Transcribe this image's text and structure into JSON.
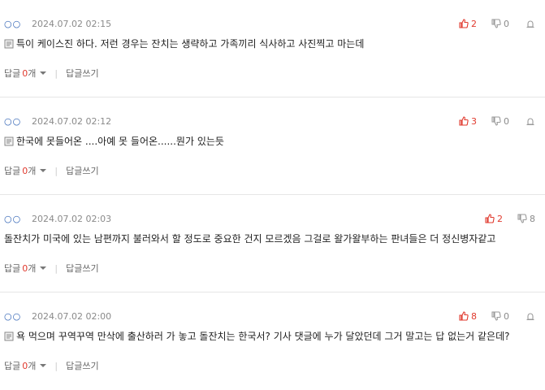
{
  "comments": [
    {
      "nick": "○○",
      "date": "2024.07.02 02:15",
      "up": "2",
      "down": "0",
      "text": "특이 케이스진 하다. 저런 경우는 잔치는 생략하고 가족끼리 식사하고 사진찍고 마는데",
      "reply_label": "답글",
      "reply_count": "0",
      "reply_unit": "개",
      "write_label": "답글쓰기"
    },
    {
      "nick": "○○",
      "date": "2024.07.02 02:12",
      "up": "3",
      "down": "0",
      "text": "한국에 못들어온 ....아예 못 들어온......뭔가 있는듯",
      "reply_label": "답글",
      "reply_count": "0",
      "reply_unit": "개",
      "write_label": "답글쓰기"
    },
    {
      "nick": "○○",
      "date": "2024.07.02 02:03",
      "up": "2",
      "down": "8",
      "text": "돌잔치가 미국에 있는 남편까지 불러와서 할 정도로 중요한 건지 모르겠음 그걸로 왈가왈부하는 판녀들은 더 정신병자같고",
      "reply_label": "답글",
      "reply_count": "0",
      "reply_unit": "개",
      "write_label": "답글쓰기"
    },
    {
      "nick": "○○",
      "date": "2024.07.02 02:00",
      "up": "8",
      "down": "0",
      "text": "욕 먹으며 꾸역꾸역 만삭에 출산하러 가 놓고 돌잔치는 한국서? 기사 댓글에 누가 달았던데 그거 말고는 답 없는거 같은데?",
      "reply_label": "답글",
      "reply_count": "0",
      "reply_unit": "개",
      "write_label": "답글쓰기"
    }
  ]
}
